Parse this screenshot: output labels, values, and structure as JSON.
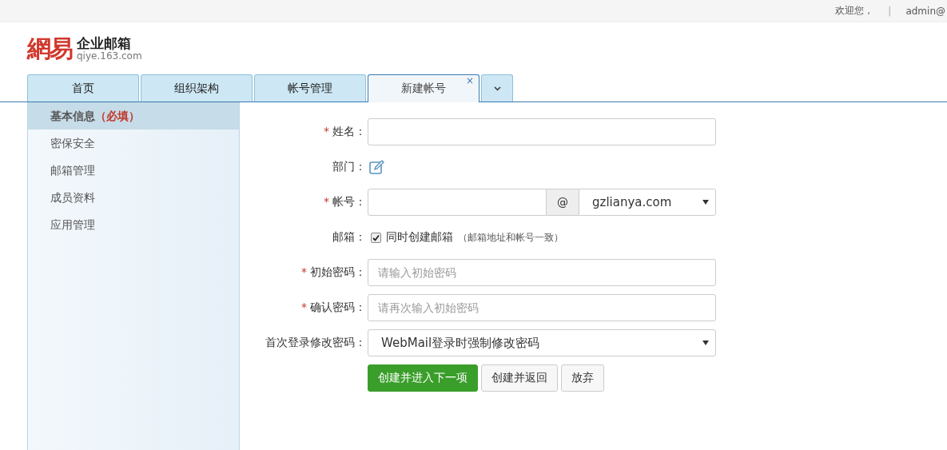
{
  "top_bar": {
    "welcome": "欢迎您，",
    "separator": "|",
    "user": "admin@"
  },
  "logo": {
    "mark": "網易",
    "product": "企业邮箱",
    "domain": "qiye.163.com"
  },
  "tabs": [
    {
      "label": "首页",
      "selected": false
    },
    {
      "label": "组织架构",
      "selected": false
    },
    {
      "label": "帐号管理",
      "selected": false
    },
    {
      "label": "新建帐号",
      "selected": true,
      "close": "×"
    }
  ],
  "sidebar": {
    "items": [
      {
        "label": "基本信息",
        "note": "（必填）",
        "selected": true
      },
      {
        "label": "密保安全",
        "selected": false
      },
      {
        "label": "邮箱管理",
        "selected": false
      },
      {
        "label": "成员资料",
        "selected": false
      },
      {
        "label": "应用管理",
        "selected": false
      }
    ]
  },
  "form": {
    "rows": [
      {
        "kind": "text",
        "required_mark": "*",
        "label": "姓名："
      },
      {
        "kind": "edit",
        "label": "部门："
      },
      {
        "kind": "account",
        "required_mark": "*",
        "label": "帐号：",
        "at": "@",
        "domain": "gzlianya.com"
      },
      {
        "kind": "checkbox",
        "label": "邮箱：",
        "checked": true,
        "text": "同时创建邮箱",
        "note": "（邮箱地址和帐号一致）"
      },
      {
        "kind": "text",
        "required_mark": "*",
        "label": "初始密码：",
        "placeholder": "请输入初始密码"
      },
      {
        "kind": "text",
        "required_mark": "*",
        "label": "确认密码：",
        "placeholder": "请再次输入初始密码"
      },
      {
        "kind": "select",
        "label": "首次登录修改密码：",
        "value": "WebMail登录时强制修改密码"
      }
    ],
    "buttons": [
      {
        "label": "创建并进入下一项",
        "kind": "primary"
      },
      {
        "label": "创建并返回",
        "kind": "default"
      },
      {
        "label": "放弃",
        "kind": "default"
      }
    ]
  }
}
